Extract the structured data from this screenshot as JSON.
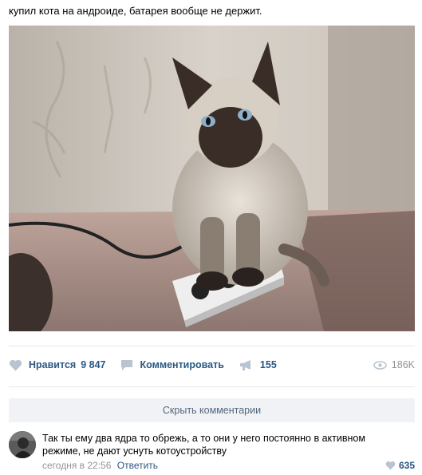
{
  "post": {
    "text": "купил кота на андроиде, батарея вообще не держит."
  },
  "actions": {
    "like_label": "Нравится",
    "like_count": "9 847",
    "comment_label": "Комментировать",
    "share_count": "155",
    "views_count": "186K",
    "icons": [
      "heart-icon",
      "comment-icon",
      "megaphone-icon",
      "eye-icon"
    ]
  },
  "comments": {
    "hide_label": "Скрыть комментарии",
    "items": [
      {
        "text": "Так ты ему два ядра то обрежь, а то они у него постоянно в активном режиме, не дают уснуть котоустройству",
        "time": "сегодня в 22:56",
        "reply_label": "Ответить",
        "likes": "635"
      }
    ]
  },
  "colors": {
    "link": "#2a5885",
    "muted": "#939393",
    "button_bg": "#f0f2f5",
    "icon": "#b8c4d0"
  }
}
